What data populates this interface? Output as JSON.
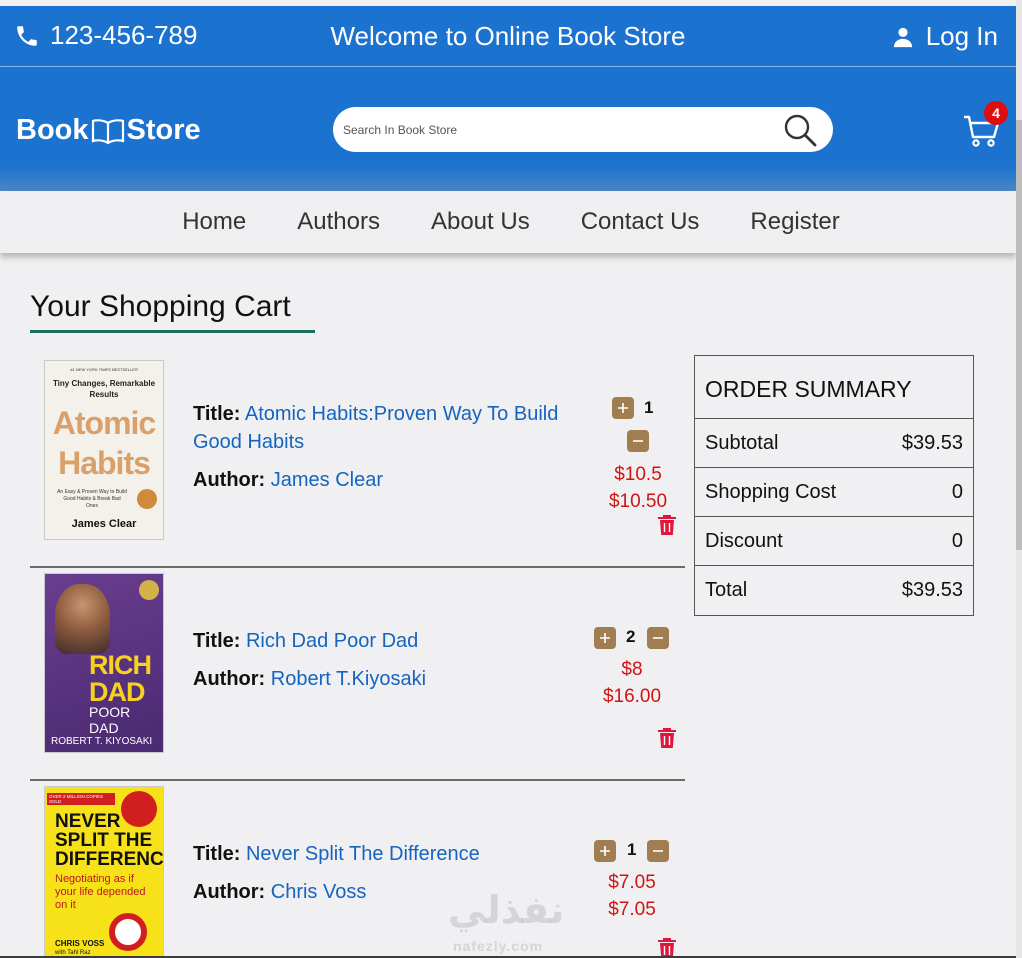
{
  "topbar": {
    "phone": "123-456-789",
    "welcome": "Welcome to Online Book Store",
    "login_label": "Log In"
  },
  "header": {
    "logo_left": "Book",
    "logo_right": "Store",
    "search_placeholder": "Search In Book Store",
    "cart_count": "4"
  },
  "nav": {
    "items": [
      "Home",
      "Authors",
      "About Us",
      "Contact Us",
      "Register"
    ]
  },
  "cart": {
    "title": "Your Shopping Cart",
    "title_label": "Title:",
    "author_label": "Author:",
    "items": [
      {
        "title": "Atomic Habits:Proven Way To Build Good Habits",
        "author": "James Clear",
        "quantity": "1",
        "unit_price": "$10.5",
        "total_price": "$10.50",
        "cover": {
          "top": "#1 NEW YORK TIMES BESTSELLER",
          "tag": "Tiny Changes, Remarkable Results",
          "main1": "Atomic",
          "main2": "Habits",
          "sub": "An Easy & Proven Way to Build Good Habits & Break Bad Ones",
          "author": "James Clear"
        }
      },
      {
        "title": "Rich Dad Poor Dad",
        "author": "Robert T.Kiyosaki",
        "quantity": "2",
        "unit_price": "$8",
        "total_price": "$16.00",
        "cover": {
          "main1": "RICH",
          "main2": "DAD",
          "main3": "POOR DAD",
          "author": "ROBERT T. KIYOSAKI"
        }
      },
      {
        "title": "Never Split The Difference",
        "author": "Chris Voss",
        "quantity": "1",
        "unit_price": "$7.05",
        "total_price": "$7.05",
        "cover": {
          "top": "OVER 2 MILLION COPIES SOLD",
          "main1": "NEVER",
          "main2": "SPLIT THE",
          "main3": "DIFFERENCE",
          "sub": "Negotiating as if your life depended on it",
          "author": "CHRIS VOSS",
          "author2": "with Tahl Raz"
        }
      }
    ]
  },
  "summary": {
    "heading": "ORDER SUMMARY",
    "rows": [
      {
        "label": "Subtotal",
        "value": "$39.53"
      },
      {
        "label": "Shopping Cost",
        "value": "0"
      },
      {
        "label": "Discount",
        "value": "0"
      },
      {
        "label": "Total",
        "value": "$39.53"
      }
    ]
  },
  "watermark": {
    "arabic": "نفذلي",
    "latin": "nafezly.com"
  },
  "colors": {
    "primary": "#1b73cf",
    "accent_brown": "#a07e52",
    "price_red": "#d01414",
    "link_blue": "#1565c0",
    "badge_red": "#e00d0d"
  }
}
